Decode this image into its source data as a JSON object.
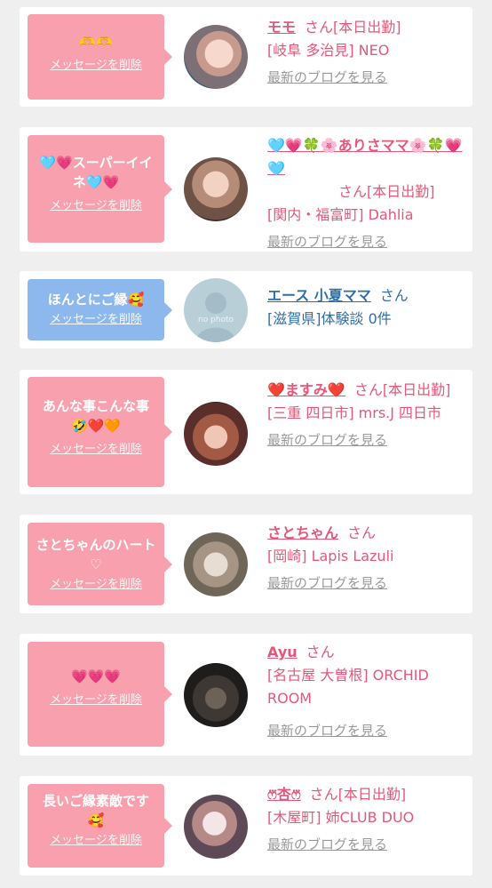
{
  "delete_label": "メッセージを削除",
  "blog_label": "最新のブログを見る",
  "san": "さん",
  "nophoto": "no photo",
  "cards": [
    {
      "message": "🫶🫶",
      "name": "モモ",
      "tag": "[本日出勤]",
      "area": "[岐阜 多治見] NEO"
    },
    {
      "message": "🩵💗スーパーイイネ🩵💗",
      "name": "🩵💗🍀🌸ありさママ🌸🍀💗🩵",
      "tag": "[本日出勤]",
      "area": "[関内・福富町] Dahlia"
    },
    {
      "message": "ほんとにご縁🥰",
      "name": "エース 小夏ママ",
      "area": "[滋賀県]体験談 0件"
    },
    {
      "message": "あんな事こんな事🤣❤️🧡",
      "name": "❤️ますみ❤️",
      "tag": "[本日出勤]",
      "area": "[三重 四日市] mrs.J 四日市"
    },
    {
      "message": "さとちゃんのハート♡",
      "name": "さとちゃん",
      "area": "[岡崎] Lapis Lazuli"
    },
    {
      "message": "💗💗💗",
      "name": "Ayu",
      "area": "[名古屋 大曽根] ORCHID ROOM"
    },
    {
      "message": "長いご縁素敵です🥰",
      "name": "ෆ⃛杏ෆ⃛",
      "tag": "[本日出勤]",
      "area": "[木屋町] 姉CLUB DUO"
    }
  ],
  "colors": {
    "pink_bubble": "#f8a0ae",
    "blue_bubble": "#8db8ee",
    "pink_text": "#e4577a",
    "blue_text": "#2e6fa8"
  }
}
